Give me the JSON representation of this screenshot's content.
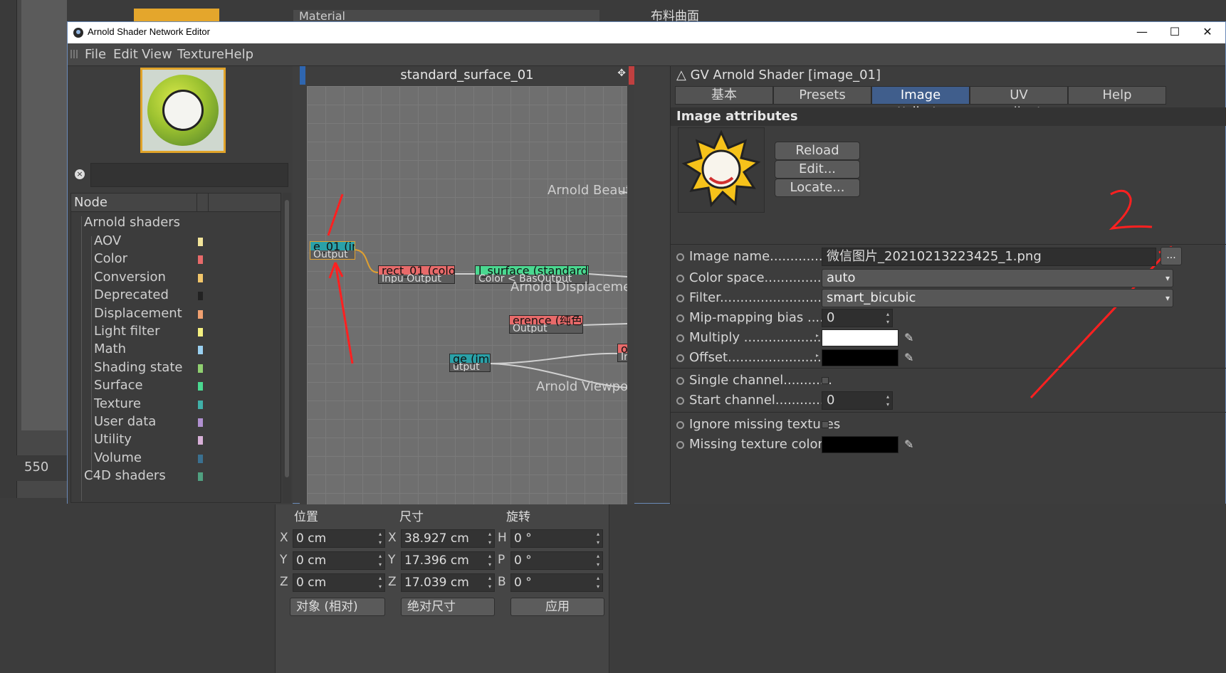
{
  "window": {
    "title": "Arnold Shader Network Editor"
  },
  "menu": [
    "File",
    "Edit",
    "View",
    "Texture",
    "Help"
  ],
  "node_browser": {
    "column_header": "Node",
    "root_category": "Arnold shaders",
    "categories": [
      {
        "label": "AOV",
        "color": "#f2e49a"
      },
      {
        "label": "Color",
        "color": "#e86a6a"
      },
      {
        "label": "Conversion",
        "color": "#f2c66a"
      },
      {
        "label": "Deprecated",
        "color": "#222222"
      },
      {
        "label": "Displacement",
        "color": "#f0a070"
      },
      {
        "label": "Light filter",
        "color": "#f4f080"
      },
      {
        "label": "Math",
        "color": "#9ad0f0"
      },
      {
        "label": "Shading state",
        "color": "#90d070"
      },
      {
        "label": "Surface",
        "color": "#4ad890"
      },
      {
        "label": "Texture",
        "color": "#40b0a8"
      },
      {
        "label": "User data",
        "color": "#b090d0"
      },
      {
        "label": "Utility",
        "color": "#d8b0d8"
      },
      {
        "label": "Volume",
        "color": "#3a7090"
      }
    ],
    "next_root": "C4D shaders",
    "next_root_color": "#50a080"
  },
  "graph": {
    "title": "standard_surface_01",
    "nodes": [
      {
        "name": "image-node",
        "top": "e_01 (in",
        "bottom": "Output",
        "color": "#2aa1a8"
      },
      {
        "name": "color-correct-node",
        "top": "rect_01 (colo",
        "bottom": "Inpu Output",
        "color": "#e86a6a"
      },
      {
        "name": "standard-surface-node",
        "top": "l_surface (standard",
        "bottom": "Color < BasOutput",
        "color": "#4ad890"
      },
      {
        "name": "reference-node",
        "top": "erence (纯色",
        "bottom": "Output",
        "color": "#e86a6a"
      },
      {
        "name": "image-node-2",
        "top": "ge (im",
        "bottom": "utput",
        "color": "#2aa1a8"
      },
      {
        "name": "output-node",
        "top": "ol",
        "bottom": "In",
        "color": "#e86a6a"
      }
    ],
    "ports": {
      "beauty": "Arnold Beauty",
      "displacement": "Arnold Displacement",
      "viewport": "Arnold Viewport"
    },
    "annotation_colors": {
      "arrow": "#ff2020"
    }
  },
  "attributes": {
    "header": "GV Arnold Shader [image_01]",
    "tabs": [
      "基本",
      "Presets",
      "Image attributes",
      "UV coordinates",
      "Help"
    ],
    "active_tab": "Image attributes",
    "section_title": "Image attributes",
    "buttons": {
      "reload": "Reload",
      "edit": "Edit...",
      "locate": "Locate..."
    },
    "browse_button": "...",
    "annotation_number": "2",
    "rows": {
      "image_name": {
        "label": "Image name",
        "value": "微信图片_20210213223425_1.png"
      },
      "color_space": {
        "label": "Color space",
        "value": "auto"
      },
      "filter": {
        "label": "Filter",
        "value": "smart_bicubic"
      },
      "mip_bias": {
        "label": "Mip-mapping bias",
        "value": "0"
      },
      "multiply": {
        "label": "Multiply",
        "color": "#ffffff"
      },
      "offset": {
        "label": "Offset",
        "color": "#000000"
      },
      "single_channel": {
        "label": "Single channel"
      },
      "start_channel": {
        "label": "Start channel",
        "value": "0"
      },
      "ignore_missing": {
        "label": "Ignore missing textures"
      },
      "missing_color": {
        "label": "Missing texture color",
        "color": "#000000"
      }
    }
  },
  "background_app": {
    "material_header": "Material",
    "tree_item": "布料曲面",
    "ruler_value": "550",
    "coords": {
      "headers": [
        "位置",
        "尺寸",
        "旋转"
      ],
      "pos": {
        "x": "0 cm",
        "y": "0 cm",
        "z": "0 cm"
      },
      "size": {
        "x": "38.927 cm",
        "y": "17.396 cm",
        "z": "17.039 cm"
      },
      "rot": {
        "h": "0 °",
        "p": "0 °",
        "b": "0 °"
      },
      "axis_xyz": [
        "X",
        "Y",
        "Z"
      ],
      "axis_hpb": [
        "H",
        "P",
        "B"
      ],
      "mode_dropdown": "对象 (相对)",
      "size_dropdown": "绝对尺寸",
      "apply_button": "应用"
    }
  }
}
